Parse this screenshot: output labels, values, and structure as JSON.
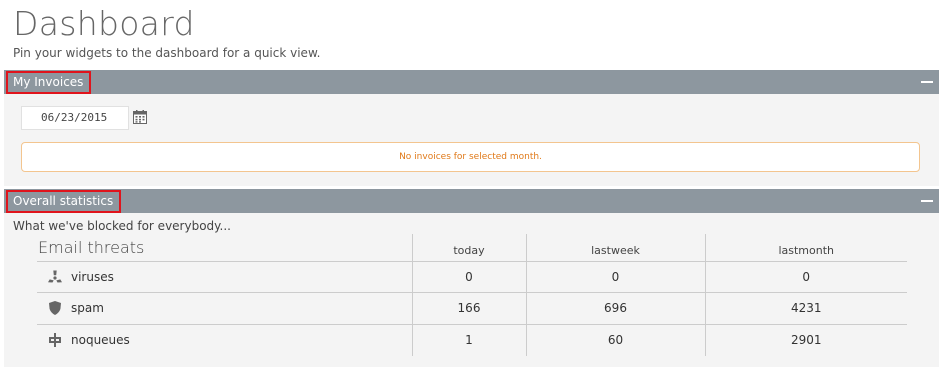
{
  "page": {
    "title": "Dashboard",
    "subtitle": "Pin your widgets to the dashboard for a quick view."
  },
  "invoices": {
    "header": "My Invoices",
    "date_value": "06/23/2015",
    "empty_message": "No invoices for selected month."
  },
  "stats": {
    "header": "Overall statistics",
    "intro": "What we've blocked for everybody...",
    "category": "Email threats",
    "columns": [
      "today",
      "lastweek",
      "lastmonth"
    ],
    "rows": [
      {
        "label": "viruses",
        "icon": "biohazard-icon",
        "values": [
          "0",
          "0",
          "0"
        ]
      },
      {
        "label": "spam",
        "icon": "shield-icon",
        "values": [
          "166",
          "696",
          "4231"
        ]
      },
      {
        "label": "noqueues",
        "icon": "queue-icon",
        "values": [
          "1",
          "60",
          "2901"
        ]
      }
    ]
  },
  "colors": {
    "header_bar": "#8d979f",
    "highlight_border": "#e0141c",
    "notice_text": "#e07a1a",
    "notice_border": "#f3c58f"
  }
}
